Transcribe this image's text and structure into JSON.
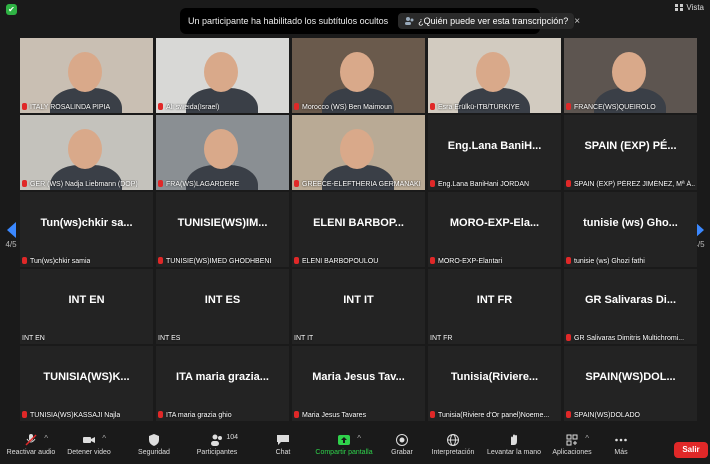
{
  "top": {
    "view_label": "Vista",
    "notice_text": "Un participante ha habilitado los subtítulos ocultos",
    "notice_link": "¿Quién puede ver esta transcripción?",
    "close_glyph": "×"
  },
  "pager": {
    "left": "4/5",
    "right": "4/5"
  },
  "tiles": [
    {
      "label": "ITALY ROSALINDA PIPIA",
      "display": "",
      "video": true,
      "bg": "#c9bfb3"
    },
    {
      "label": "Ali sweida(Israel)",
      "display": "",
      "video": true,
      "bg": "#d8d8d6"
    },
    {
      "label": "Morocco (WS) Ben Maimoun",
      "display": "",
      "video": true,
      "bg": "#6a5a4c"
    },
    {
      "label": "Esra Erülkü-İTB/TÜRKİYE",
      "display": "",
      "video": true,
      "bg": "#d2cbc0"
    },
    {
      "label": "FRANCE(WS)QUEIROLO",
      "display": "",
      "video": true,
      "bg": "#5d5550"
    },
    {
      "label": "GER (WS) Nadja Liebmann (DOP)",
      "display": "",
      "video": true,
      "bg": "#c4c2bc"
    },
    {
      "label": "FRA(WS)LAGARDERE",
      "display": "",
      "video": true,
      "bg": "#8a8f93"
    },
    {
      "label": "GREECE-ELEFTHERIA GERMANAKI",
      "display": "",
      "video": true,
      "bg": "#b9aa95"
    },
    {
      "label": "Eng.Lana BaniHani JORDAN",
      "display": "Eng.Lana BaniH...",
      "video": false
    },
    {
      "label": "SPAIN (EXP) PÉREZ JIMÉNEZ, Mª Á...",
      "display": "SPAIN (EXP) PÉ...",
      "video": false
    },
    {
      "label": "Tun(ws)chkir samia",
      "display": "Tun(ws)chkir sa...",
      "video": false
    },
    {
      "label": "TUNISIE(WS)IMED GHODHBENI",
      "display": "TUNISIE(WS)IM...",
      "video": false
    },
    {
      "label": "ELENI BARBOPOULOU",
      "display": "ELENI BARBOP...",
      "video": false
    },
    {
      "label": "MORO-EXP-Elantari",
      "display": "MORO-EXP-Ela...",
      "video": false
    },
    {
      "label": "tunisie (ws) Ghozi fathi",
      "display": "tunisie (ws) Gho...",
      "video": false
    },
    {
      "label": "INT EN",
      "display": "INT EN",
      "video": false,
      "nomic": true
    },
    {
      "label": "INT ES",
      "display": "INT ES",
      "video": false,
      "nomic": true
    },
    {
      "label": "INT IT",
      "display": "INT IT",
      "video": false,
      "nomic": true
    },
    {
      "label": "INT FR",
      "display": "INT FR",
      "video": false,
      "nomic": true
    },
    {
      "label": "GR Salivaras Dimitris Multichromi...",
      "display": "GR Salivaras Di...",
      "video": false
    },
    {
      "label": "TUNISIA(WS)KASSAJI Najla",
      "display": "TUNISIA(WS)K...",
      "video": false
    },
    {
      "label": "ITA maria grazia ghio",
      "display": "ITA maria grazia...",
      "video": false
    },
    {
      "label": "Maria Jesus Tavares",
      "display": "Maria Jesus Tav...",
      "video": false
    },
    {
      "label": "Tunisia(Riviere d'Or panel)Noeme...",
      "display": "Tunisia(Riviere...",
      "video": false
    },
    {
      "label": "SPAIN(WS)DOLADO",
      "display": "SPAIN(WS)DOL...",
      "video": false
    }
  ],
  "toolbar": {
    "audio": "Reactivar audio",
    "video": "Detener video",
    "security": "Seguridad",
    "participants": "Participantes",
    "participants_count": "104",
    "chat": "Chat",
    "share": "Compartir pantalla",
    "record": "Grabar",
    "interpretation": "Interpretación",
    "raise_hand": "Levantar la mano",
    "apps": "Aplicaciones",
    "more": "Más",
    "leave": "Salir"
  },
  "colors": {
    "accent_blue": "#3b88ff",
    "share_green": "#2fd14b",
    "leave_red": "#e02828",
    "mute_red": "#e02828"
  }
}
